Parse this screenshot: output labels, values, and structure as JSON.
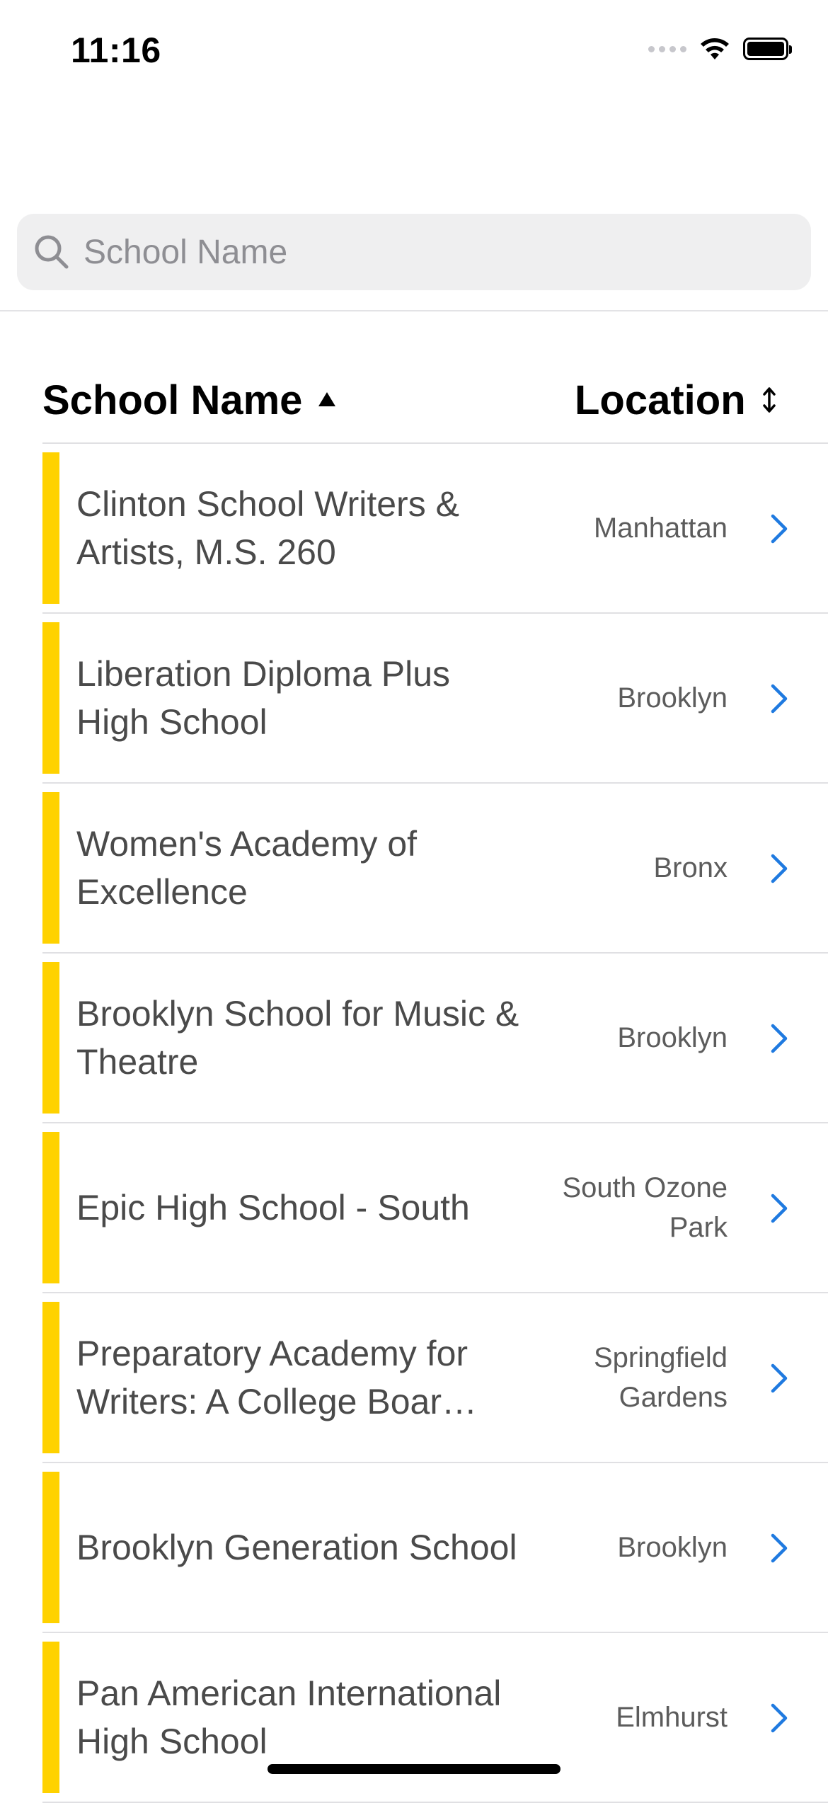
{
  "status_bar": {
    "time": "11:16"
  },
  "search": {
    "placeholder": "School Name",
    "value": ""
  },
  "table": {
    "headers": {
      "name": "School Name",
      "name_sort": "ascending",
      "location": "Location",
      "location_sort": "unsorted"
    },
    "rows": [
      {
        "name": "Clinton School Writers & Artists, M.S. 260",
        "location": "Manhattan"
      },
      {
        "name": "Liberation Diploma Plus High School",
        "location": "Brooklyn"
      },
      {
        "name": "Women's Academy of Excellence",
        "location": "Bronx"
      },
      {
        "name": "Brooklyn School for Music & Theatre",
        "location": "Brooklyn"
      },
      {
        "name": "Epic High School - South",
        "location": "South Ozone Park"
      },
      {
        "name": "Preparatory Academy for Writers: A College Boar…",
        "location": "Springfield Gardens"
      },
      {
        "name": "Brooklyn Generation School",
        "location": "Brooklyn"
      },
      {
        "name": "Pan American International High School",
        "location": "Elmhurst"
      }
    ]
  },
  "colors": {
    "accent_bar": "#ffd200",
    "chevron": "#1f7ae0",
    "search_background": "#efeff0",
    "placeholder": "#8e8e93"
  },
  "icons": {
    "search": "search-icon",
    "sort_asc": "sort-ascending-icon",
    "sort_both": "sort-both-icon",
    "row_disclosure": "chevron-right-icon",
    "wifi": "wifi-icon",
    "battery": "battery-icon"
  }
}
